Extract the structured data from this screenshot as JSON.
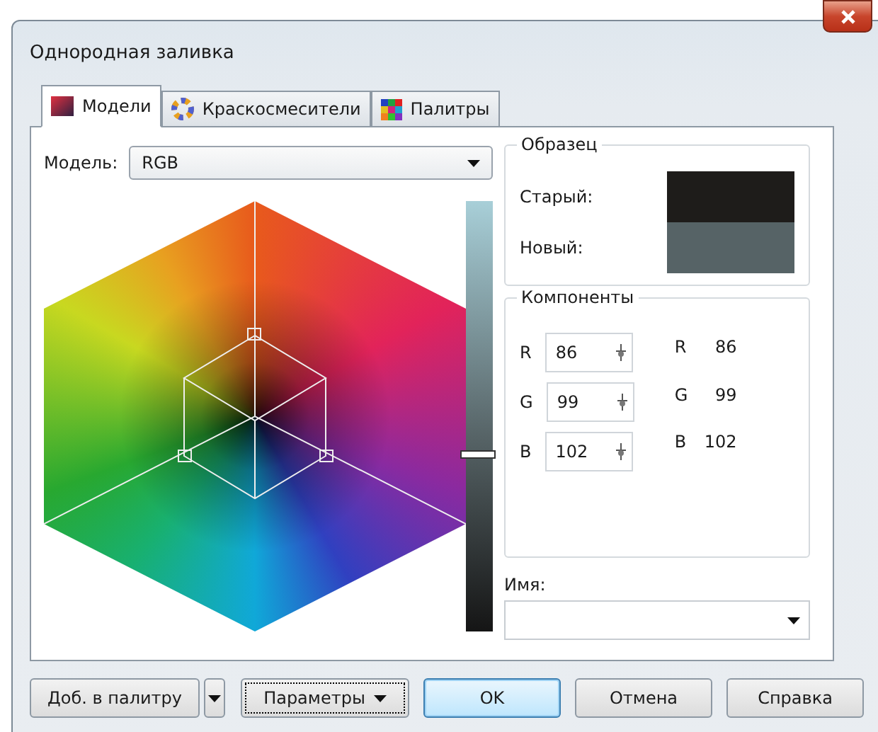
{
  "window": {
    "title": "Однородная заливка"
  },
  "tabs": [
    {
      "label": "Модели",
      "selected": true,
      "kind": "models"
    },
    {
      "label": "Краскосмесители",
      "selected": false,
      "kind": "mixers"
    },
    {
      "label": "Палитры",
      "selected": false,
      "kind": "palettes"
    }
  ],
  "model": {
    "label": "Модель:",
    "value": "RGB"
  },
  "brightness": {
    "level": 0.41
  },
  "sample": {
    "title": "Образец",
    "swatches": [
      {
        "label": "Старый:",
        "color": "#1e1c1a"
      },
      {
        "label": "Новый:",
        "color": "#566366"
      }
    ]
  },
  "components": {
    "title": "Компоненты",
    "fields": [
      {
        "label": "R",
        "value": "86"
      },
      {
        "label": "G",
        "value": "99"
      },
      {
        "label": "B",
        "value": "102"
      }
    ],
    "readout": [
      {
        "label": "R",
        "value": "86"
      },
      {
        "label": "G",
        "value": "99"
      },
      {
        "label": "B",
        "value": "102"
      }
    ]
  },
  "name": {
    "label": "Имя:"
  },
  "buttons": [
    {
      "label": "Доб. в палитру",
      "kind": "split"
    },
    {
      "label": "Параметры",
      "kind": "menu"
    },
    {
      "label": "OK",
      "kind": "default"
    },
    {
      "label": "Отмена",
      "kind": "normal"
    },
    {
      "label": "Справка",
      "kind": "normal"
    }
  ]
}
